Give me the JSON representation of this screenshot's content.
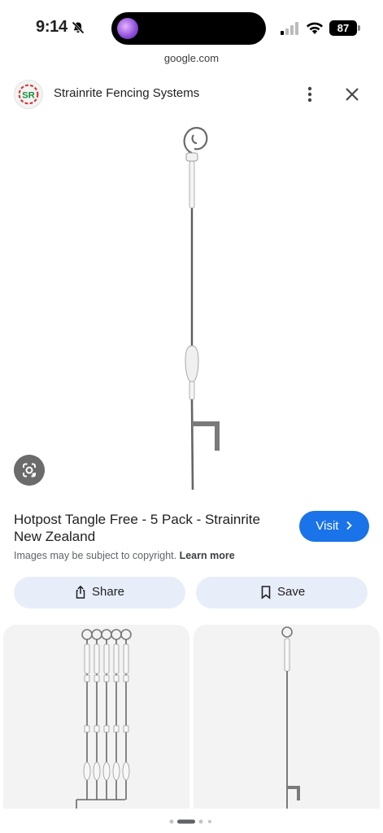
{
  "status_bar": {
    "time": "9:14",
    "battery": "87"
  },
  "url": "google.com",
  "site": {
    "name": "Strainrite Fencing Systems",
    "logo_text": "SR"
  },
  "result": {
    "title": "Hotpost Tangle Free - 5 Pack - Strainrite New Zealand",
    "visit_label": "Visit",
    "copyright_note": "Images may be subject to copyright.",
    "learn_more": "Learn more"
  },
  "actions": {
    "share_label": "Share",
    "save_label": "Save"
  },
  "icons": {
    "bell": "bell-slash-icon",
    "signal": "cellular-signal-icon",
    "wifi": "wifi-icon",
    "more": "more-vert-icon",
    "close": "close-icon",
    "lens": "google-lens-icon",
    "share": "share-icon",
    "save": "bookmark-icon",
    "visit": "chevron-right-icon"
  },
  "colors": {
    "accent": "#1a73e8",
    "action_bg": "#e8eef9",
    "logo_red": "#d93025",
    "logo_green": "#1e8e3e"
  }
}
